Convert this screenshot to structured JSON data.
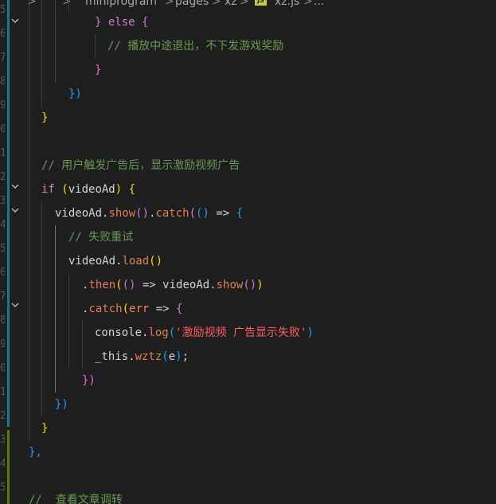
{
  "breadcrumb": {
    "root": "miniprogram",
    "folder1": "pages",
    "folder2": "xz",
    "file_badge": "JS",
    "file": "xz.js",
    "more": "...",
    "separator": ">"
  },
  "colors": {
    "background": "#1e1e1e",
    "git_modified_stripe": "#0c7d9d",
    "git_added_stripe": "#587c0c",
    "comment": "#6a9955",
    "string": "#ff5d5d",
    "function": "#e27e55"
  },
  "icons": {
    "fold": "chevron-down-icon"
  },
  "lines": [
    {
      "tokens": [
        {
          "t": "} ",
          "c": "b2"
        },
        {
          "t": "else",
          "c": "kw"
        },
        {
          "t": " ",
          "c": "plain"
        },
        {
          "t": "{",
          "c": "b2"
        }
      ]
    },
    {
      "tokens": [
        {
          "t": "// 播放中途退出，不下发游戏奖励",
          "c": "cmt"
        }
      ]
    },
    {
      "tokens": [
        {
          "t": "}",
          "c": "b2"
        }
      ]
    },
    {
      "tokens": [
        {
          "t": "})",
          "c": "b3"
        }
      ]
    },
    {
      "tokens": [
        {
          "t": "}",
          "c": "b1"
        }
      ]
    },
    {
      "tokens": []
    },
    {
      "tokens": [
        {
          "t": "// 用户触发广告后，显示激励视频广告",
          "c": "cmt"
        }
      ]
    },
    {
      "tokens": [
        {
          "t": "if",
          "c": "kw"
        },
        {
          "t": " ",
          "c": "plain"
        },
        {
          "t": "(",
          "c": "b1"
        },
        {
          "t": "videoAd",
          "c": "var"
        },
        {
          "t": ")",
          "c": "b1"
        },
        {
          "t": " ",
          "c": "plain"
        },
        {
          "t": "{",
          "c": "b1"
        }
      ]
    },
    {
      "tokens": [
        {
          "t": "videoAd.",
          "c": "var"
        },
        {
          "t": "show",
          "c": "fn"
        },
        {
          "t": "()",
          "c": "b2"
        },
        {
          "t": ".",
          "c": "plain"
        },
        {
          "t": "catch",
          "c": "fn"
        },
        {
          "t": "(",
          "c": "b2"
        },
        {
          "t": "()",
          "c": "b3"
        },
        {
          "t": " => ",
          "c": "arrow"
        },
        {
          "t": "{",
          "c": "b3"
        }
      ]
    },
    {
      "tokens": [
        {
          "t": "// 失败重试",
          "c": "cmt"
        }
      ]
    },
    {
      "tokens": [
        {
          "t": "videoAd.",
          "c": "var"
        },
        {
          "t": "load",
          "c": "fn"
        },
        {
          "t": "()",
          "c": "b1"
        }
      ]
    },
    {
      "tokens": [
        {
          "t": ".",
          "c": "plain"
        },
        {
          "t": "then",
          "c": "fn"
        },
        {
          "t": "(",
          "c": "b1"
        },
        {
          "t": "()",
          "c": "b2"
        },
        {
          "t": " => ",
          "c": "arrow"
        },
        {
          "t": "videoAd.",
          "c": "var"
        },
        {
          "t": "show",
          "c": "fn"
        },
        {
          "t": "()",
          "c": "b2"
        },
        {
          "t": ")",
          "c": "b1"
        }
      ]
    },
    {
      "tokens": [
        {
          "t": ".",
          "c": "plain"
        },
        {
          "t": "catch",
          "c": "fn"
        },
        {
          "t": "(",
          "c": "b1"
        },
        {
          "t": "err",
          "c": "prm"
        },
        {
          "t": " => ",
          "c": "arrow"
        },
        {
          "t": "{",
          "c": "b2"
        }
      ]
    },
    {
      "tokens": [
        {
          "t": "console.",
          "c": "var"
        },
        {
          "t": "log",
          "c": "fn"
        },
        {
          "t": "(",
          "c": "b3"
        },
        {
          "t": "'激励视频 广告显示失败'",
          "c": "str"
        },
        {
          "t": ")",
          "c": "b3"
        }
      ]
    },
    {
      "tokens": [
        {
          "t": "_this.",
          "c": "var"
        },
        {
          "t": "wztz",
          "c": "fn"
        },
        {
          "t": "(",
          "c": "b3"
        },
        {
          "t": "e",
          "c": "var"
        },
        {
          "t": ")",
          "c": "b3"
        },
        {
          "t": ";",
          "c": "plain"
        }
      ]
    },
    {
      "tokens": [
        {
          "t": "})",
          "c": "b2"
        }
      ]
    },
    {
      "tokens": [
        {
          "t": "})",
          "c": "b3"
        }
      ]
    },
    {
      "tokens": [
        {
          "t": "}",
          "c": "b1"
        }
      ]
    },
    {
      "tokens": [
        {
          "t": "},",
          "c": "b3"
        }
      ]
    },
    {
      "tokens": []
    },
    {
      "tokens": [
        {
          "t": "//  查看文章调转",
          "c": "cmt"
        }
      ]
    }
  ],
  "line_numbers": [
    "5",
    "6",
    "7",
    "8",
    "9",
    "0",
    "1",
    "2",
    "3",
    "4",
    "5",
    "6",
    "7",
    "8",
    "9",
    "0",
    "1",
    "2",
    "3",
    "4",
    "5"
  ]
}
